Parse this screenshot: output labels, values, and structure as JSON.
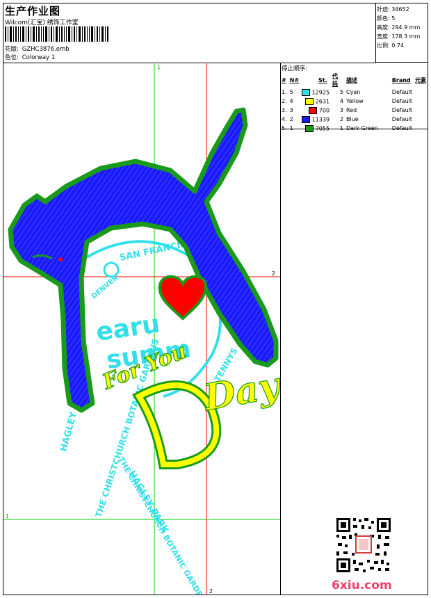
{
  "header": {
    "title": "生产作业图",
    "subtitle": "Wilcom(汇宝) 绣饰工作室",
    "design_label": "花版:",
    "design_value": "GZHC3876.emb",
    "colorway_label": "色位:",
    "colorway_value": "Colorway 1"
  },
  "stats": [
    {
      "label": "针迹:",
      "value": "34652"
    },
    {
      "label": "颜色:",
      "value": "5"
    },
    {
      "label": "高度:",
      "value": "294.9 mm"
    },
    {
      "label": "宽度:",
      "value": "178.3 mm"
    },
    {
      "label": "比例:",
      "value": "0.74"
    }
  ],
  "stops": {
    "title": "停止顺序:",
    "columns": [
      "#",
      "N#",
      "St.",
      "代码",
      "描述",
      "Brand",
      "元素"
    ],
    "rows": [
      {
        "num": "1.",
        "n": "5",
        "color": "#33e0ea",
        "st": "12925",
        "code": "5",
        "desc": "Cyan",
        "brand": "Default"
      },
      {
        "num": "2.",
        "n": "4",
        "color": "#ffff00",
        "st": "2631",
        "code": "4",
        "desc": "Yellow",
        "brand": "Default"
      },
      {
        "num": "3.",
        "n": "3",
        "color": "#ff0000",
        "st": "700",
        "code": "3",
        "desc": "Red",
        "brand": "Default"
      },
      {
        "num": "4.",
        "n": "2",
        "color": "#1a1aff",
        "st": "11339",
        "code": "2",
        "desc": "Blue",
        "brand": "Default"
      },
      {
        "num": "5.",
        "n": "1",
        "color": "#1a9a1a",
        "st": "7055",
        "code": "1",
        "desc": "Dark Green",
        "brand": "Default"
      }
    ]
  },
  "guides": {
    "green_top": "1",
    "green_left": "1",
    "red_right": "2",
    "red_bottom": "2"
  },
  "artwork": {
    "san_francisco": "SAN FRANCISCO",
    "for_you": "For You",
    "day": "Day",
    "word_big_1": "earu",
    "word_big_2": "summ",
    "hagley_1": "HAGLEY PARK",
    "hagley_2": "THE CHRISTCHURCH BOTANIC GARDENS",
    "hagley_3": "HAGLEY PARK",
    "hagley_4": "THE CHRISTCHURCH BOTANIC GARDENS",
    "tenny": "TENNYS",
    "denver": "DENVER"
  },
  "watermark": "6xiu.com",
  "colors": {
    "green": "#1a9a1a",
    "blue": "#1a1aff",
    "cyan": "#33e0ea",
    "yellow": "#ffff00",
    "red": "#ff0000"
  }
}
